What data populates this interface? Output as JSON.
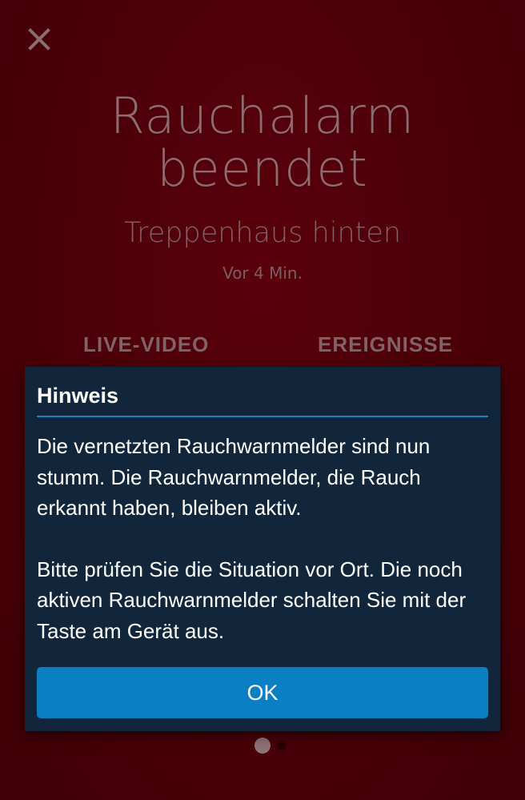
{
  "alarm": {
    "title_line1": "Rauchalarm",
    "title_line2": "beendet",
    "location": "Treppenhaus hinten",
    "timestamp": "Vor 4 Min."
  },
  "tabs": [
    {
      "label": "LIVE-VIDEO"
    },
    {
      "label": "EREIGNISSE"
    }
  ],
  "pager": {
    "current_page": 1,
    "total_pages": 2
  },
  "dialog": {
    "title": "Hinweis",
    "paragraph1": "Die vernetzten Rauchwarnmelder sind nun stumm. Die Rauchwarnmelder, die Rauch erkannt haben, bleiben aktiv.",
    "paragraph2": "Bitte prüfen Sie die Situation vor Ort. Die noch aktiven Rauchwarnmelder schalten Sie mit der Taste am Gerät aus.",
    "ok_label": "OK"
  },
  "colors": {
    "background": "#4d0008",
    "dialog_background": "#11263b",
    "accent": "#0a7fc4",
    "muted_text": "#8a6d70"
  },
  "icons": {
    "close": "close-icon"
  }
}
